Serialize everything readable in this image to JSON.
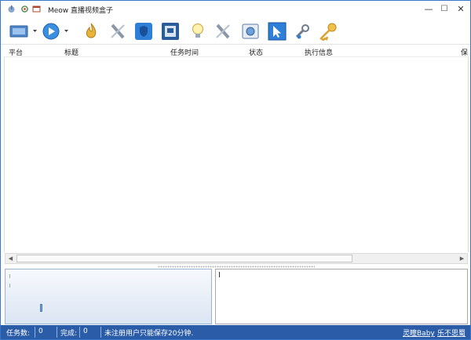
{
  "window": {
    "title": "Meow 直播视频盒子",
    "controls": {
      "minimize": "—",
      "maximize": "☐",
      "close": "✕"
    }
  },
  "toolbar": {
    "icons": [
      "screen-icon",
      "play-icon",
      "flame-icon",
      "plug-icon",
      "shield-icon",
      "disk-icon",
      "bulb-icon",
      "plug-icon",
      "monitor-icon",
      "cursor-icon",
      "wrench-icon",
      "key-icon"
    ]
  },
  "list": {
    "columns": [
      "平台",
      "标题",
      "任务时间",
      "状态",
      "执行信息",
      "保"
    ],
    "rows": []
  },
  "statusbar": {
    "task_count_label": "任务数:",
    "task_count_value": "0",
    "done_label": "完成:",
    "done_value": "0",
    "message": "未注册用户只能保存20分钟.",
    "link1": "灵瞳Baby",
    "link2": "乐不思蜀"
  },
  "colors": {
    "statusbar": "#2b5ca8",
    "border": "#3c78c8",
    "accent": "#2e7fd8"
  }
}
